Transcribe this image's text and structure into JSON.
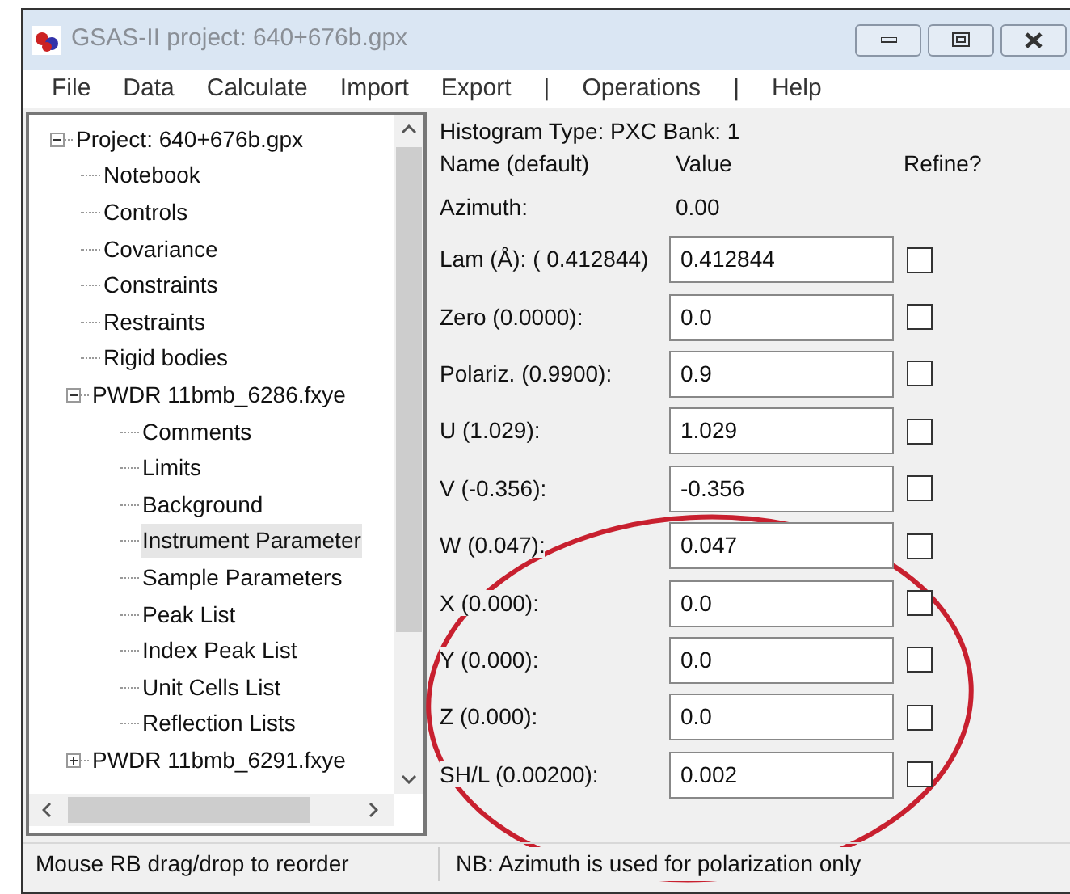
{
  "window": {
    "title": "GSAS-II project: 640+676b.gpx"
  },
  "menu": [
    "File",
    "Data",
    "Calculate",
    "Import",
    "Export",
    "|",
    "Operations",
    "|",
    "Help"
  ],
  "tree": [
    {
      "label": "Project: 640+676b.gpx",
      "expanded": true,
      "selected": false,
      "children": [
        {
          "label": "Notebook",
          "selected": false
        },
        {
          "label": "Controls",
          "selected": false
        },
        {
          "label": "Covariance",
          "selected": false
        },
        {
          "label": "Constraints",
          "selected": false
        },
        {
          "label": "Restraints",
          "selected": false
        },
        {
          "label": "Rigid bodies",
          "selected": false
        },
        {
          "label": "PWDR 11bmb_6286.fxye",
          "expanded": true,
          "selected": false,
          "children": [
            {
              "label": "Comments",
              "selected": false
            },
            {
              "label": "Limits",
              "selected": false
            },
            {
              "label": "Background",
              "selected": false
            },
            {
              "label": "Instrument Parameter",
              "selected": true
            },
            {
              "label": "Sample Parameters",
              "selected": false
            },
            {
              "label": "Peak List",
              "selected": false
            },
            {
              "label": "Index Peak List",
              "selected": false
            },
            {
              "label": "Unit Cells List",
              "selected": false
            },
            {
              "label": "Reflection Lists",
              "selected": false
            }
          ]
        },
        {
          "label": "PWDR 11bmb_6291.fxye",
          "expanded": false,
          "selected": false
        }
      ]
    }
  ],
  "panel": {
    "header": "Histogram Type: PXC  Bank: 1",
    "columns": [
      "Name (default)",
      "Value",
      "Refine?"
    ],
    "azimuth": {
      "label": "Azimuth:",
      "value": "0.00"
    },
    "params": [
      {
        "label": "Lam (Å): (  0.412844)",
        "value": "0.412844",
        "refine": false
      },
      {
        "label": "Zero (0.0000):",
        "value": "0.0",
        "refine": false
      },
      {
        "label": "Polariz. (0.9900):",
        "value": "0.9",
        "refine": false
      },
      {
        "label": "U (1.029):",
        "value": "1.029",
        "refine": false
      },
      {
        "label": "V (-0.356):",
        "value": "-0.356",
        "refine": false
      },
      {
        "label": "W (0.047):",
        "value": "0.047",
        "refine": false
      },
      {
        "label": "X (0.000):",
        "value": "0.0",
        "refine": false
      },
      {
        "label": "Y (0.000):",
        "value": "0.0",
        "refine": false
      },
      {
        "label": "Z (0.000):",
        "value": "0.0",
        "refine": false
      },
      {
        "label": "SH/L (0.00200):",
        "value": "0.002",
        "refine": false
      }
    ]
  },
  "status_bar": [
    "Mouse RB drag/drop to reorder",
    "NB: Azimuth is used for polarization only"
  ]
}
